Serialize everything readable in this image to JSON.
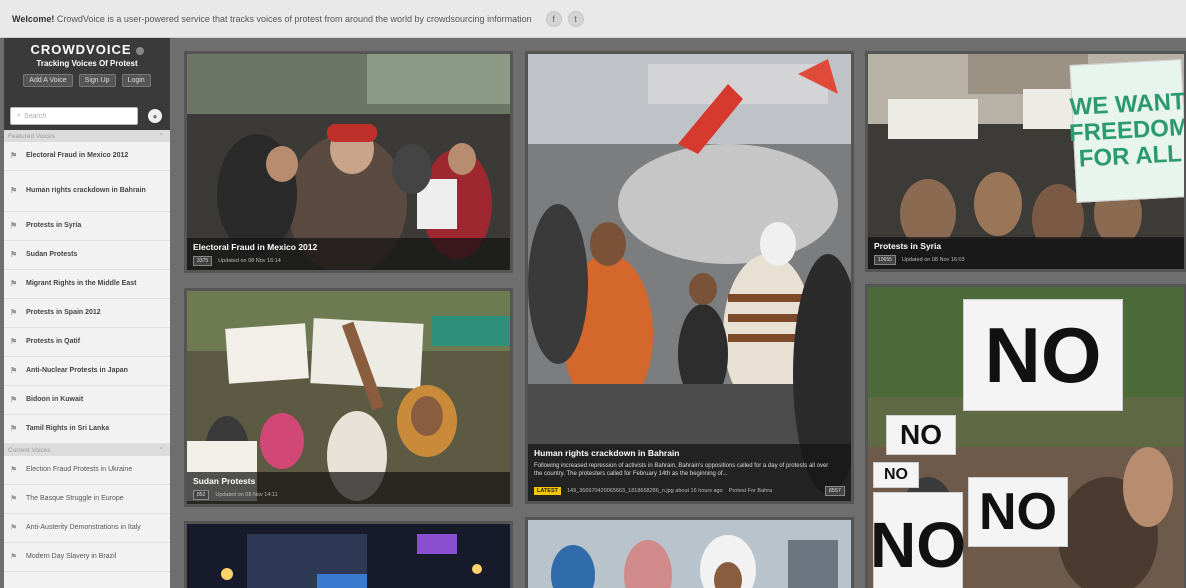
{
  "topbar": {
    "welcome_bold": "Welcome!",
    "welcome_text": "CrowdVoice is a user-powered service that tracks voices of protest from around the world by crowdsourcing information",
    "facebook": "f",
    "twitter": "t"
  },
  "brand": {
    "name": "CROWDVOICE",
    "tagline": "Tracking Voices Of Protest",
    "add_voice": "Add A Voice",
    "signup": "Sign Up",
    "login": "Login"
  },
  "search": {
    "placeholder": "Search"
  },
  "featured": {
    "heading": "Featured Voices",
    "items": [
      "Electoral Fraud in Mexico 2012",
      "Human rights crackdown in Bahrain",
      "Protests in Syria",
      "Sudan Protests",
      "Migrant Rights in the Middle East",
      "Protests in Spain 2012",
      "Protests in Qatif",
      "Anti-Nuclear Protests in Japan",
      "Bidoon in Kuwait",
      "Tamil Rights in Sri Lanka"
    ]
  },
  "current": {
    "heading": "Current Voices",
    "items": [
      "Election Fraud Protests in Ukraine",
      "The Basque Struggle in Europe",
      "Anti-Austerity Demonstrations in Italy",
      "Modern Day Slavery in Brazil"
    ]
  },
  "tiles": {
    "mexico": {
      "title": "Electoral Fraud in Mexico 2012",
      "count": "3375",
      "updated": "Updated on 08 Nov 16:14"
    },
    "bahrain": {
      "title": "Human rights crackdown in Bahrain",
      "desc": "Following increased repression of activists in Bahrain, Bahrain's oppositions called for a day of protests all over the country. The protesters called for February 14th as the beginning of...",
      "latest": "LATEST",
      "latest_text": "149_366970420065663_1818668286_n.jpg about 16 hours ago",
      "latest_src": "Protest For Bahra",
      "count": "8557"
    },
    "syria": {
      "title": "Protests in Syria",
      "count": "10655",
      "updated": "Updated on 08 Nov 16:03"
    },
    "sudan": {
      "title": "Sudan Protests",
      "count": "852",
      "updated": "Updated on 08 Nov 14:11"
    },
    "signs": {
      "freedom": "WE WANT FREEDOM FOR ALL",
      "no": "NO"
    }
  }
}
